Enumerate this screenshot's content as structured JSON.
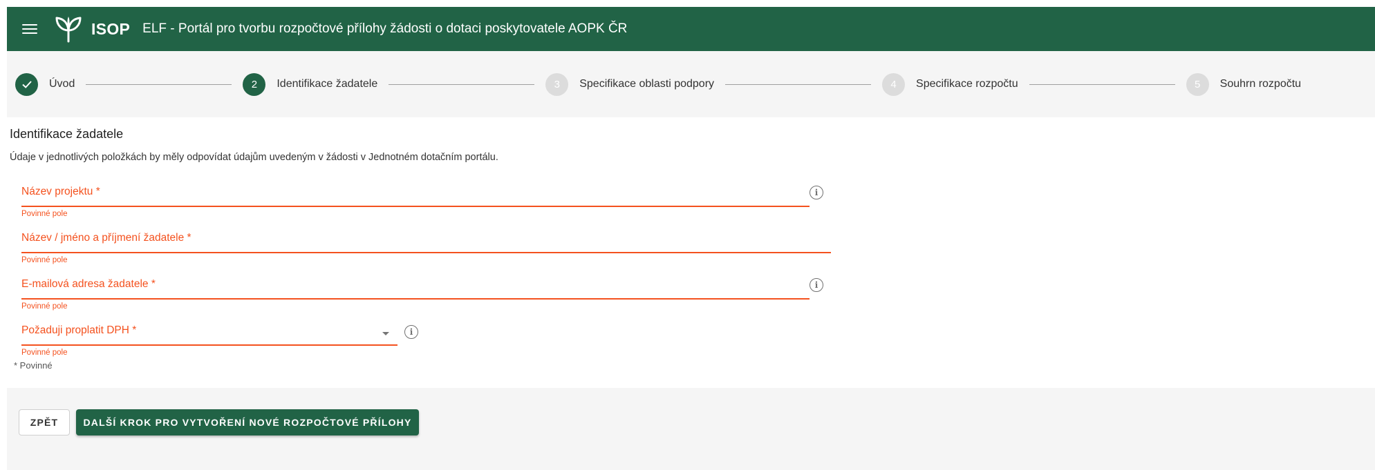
{
  "header": {
    "brand": "ISOP",
    "title": "ELF - Portál pro tvorbu rozpočtové přílohy žádosti o dotaci poskytovatele AOPK ČR",
    "color": "#216346"
  },
  "stepper": {
    "steps": [
      {
        "number": "",
        "label": "Úvod",
        "state": "done"
      },
      {
        "number": "2",
        "label": "Identifikace žadatele",
        "state": "active"
      },
      {
        "number": "3",
        "label": "Specifikace oblasti podpory",
        "state": "todo"
      },
      {
        "number": "4",
        "label": "Specifikace rozpočtu",
        "state": "todo"
      },
      {
        "number": "5",
        "label": "Souhrn rozpočtu",
        "state": "todo"
      }
    ]
  },
  "section": {
    "title": "Identifikace žadatele",
    "description": "Údaje v jednotlivých položkách by měly odpovídat údajům uvedeným v žádosti v Jednotném dotačním portálu."
  },
  "form": {
    "fields": [
      {
        "label": "Název projektu *",
        "value": "",
        "error": "Povinné pole",
        "info": true
      },
      {
        "label": "Název / jméno a příjmení žadatele *",
        "value": "",
        "error": "Povinné pole",
        "info": false
      },
      {
        "label": "E-mailová adresa žadatele *",
        "value": "",
        "error": "Povinné pole",
        "info": true
      },
      {
        "label": "Požaduji proplatit DPH *",
        "value": "",
        "error": "Povinné pole",
        "info": true,
        "type": "select"
      }
    ],
    "required_note": "* Povinné",
    "error_color": "#f4511e"
  },
  "actions": {
    "back_label": "ZPĚT",
    "next_label": "DALŠÍ KROK PRO VYTVOŘENÍ NOVÉ ROZPOČTOVÉ PŘÍLOHY"
  }
}
